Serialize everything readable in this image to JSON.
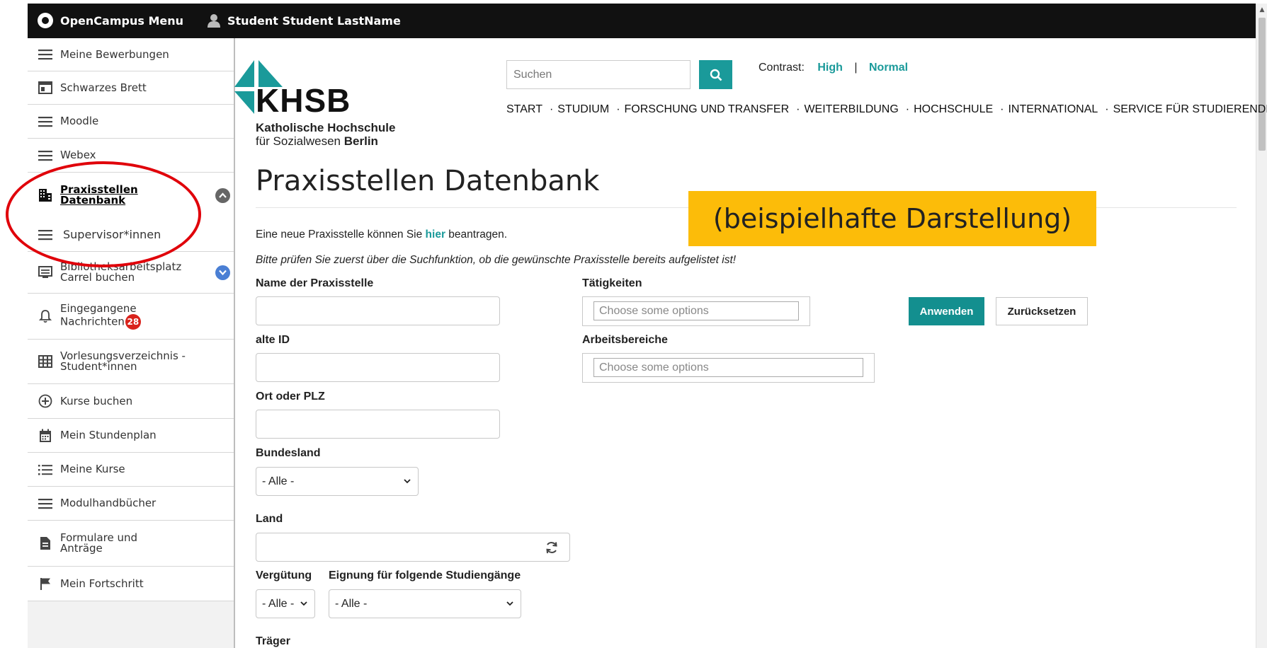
{
  "topbar": {
    "menu_label": "OpenCampus Menu",
    "user_label": "Student Student LastName"
  },
  "sidebar": {
    "items": [
      {
        "label": "Meine Bewerbungen",
        "icon": "hamburger-icon"
      },
      {
        "label": "Schwarzes Brett",
        "icon": "board-icon"
      },
      {
        "label": "Moodle",
        "icon": "hamburger-icon"
      },
      {
        "label": "Webex",
        "icon": "hamburger-icon"
      },
      {
        "label": "Praxisstellen Datenbank",
        "icon": "building-icon",
        "active": true
      },
      {
        "label": "Supervisor*innen",
        "icon": "hamburger-icon"
      },
      {
        "label": "Bibliotheksarbeitsplatz Carrel buchen",
        "icon": "monitor-icon"
      },
      {
        "label": "Eingegangene Nachrichten",
        "icon": "bell-icon",
        "badge": "28"
      },
      {
        "label": "Vorlesungsverzeichnis - Student*innen",
        "icon": "table-icon"
      },
      {
        "label": "Kurse buchen",
        "icon": "plus-circle-icon"
      },
      {
        "label": "Mein Stundenplan",
        "icon": "calendar-icon"
      },
      {
        "label": "Meine Kurse",
        "icon": "list-icon"
      },
      {
        "label": "Modulhandbücher",
        "icon": "hamburger-icon"
      },
      {
        "label": "Formulare und Anträge",
        "icon": "document-icon"
      },
      {
        "label": "Mein Fortschritt",
        "icon": "flag-icon"
      }
    ]
  },
  "logo": {
    "abbr": "KHSB",
    "line1": "Katholische Hochschule",
    "line2_prefix": "für Sozialwesen",
    "line2_bold": "Berlin"
  },
  "search": {
    "placeholder": "Suchen"
  },
  "contrast": {
    "label": "Contrast:",
    "high": "High",
    "separator": "|",
    "normal": "Normal"
  },
  "nav": {
    "items": [
      "START",
      "STUDIUM",
      "FORSCHUNG UND TRANSFER",
      "WEITERBILDUNG",
      "HOCHSCHULE",
      "INTERNATIONAL",
      "SERVICE FÜR STUDIERENDE"
    ],
    "separator": "·"
  },
  "page": {
    "title": "Praxisstellen Datenbank",
    "banner": "(beispielhafte Darstellung)",
    "intro_prefix": "Eine neue Praxisstelle können Sie",
    "intro_link": "hier",
    "intro_suffix": "beantragen.",
    "hint": "Bitte prüfen Sie zuerst über die Suchfunktion, ob die gewünschte Praxisstelle bereits aufgelistet ist!"
  },
  "form": {
    "name_label": "Name der Praxisstelle",
    "id_label": "alte ID",
    "ort_label": "Ort oder PLZ",
    "bundesland_label": "Bundesland",
    "bundesland_value": "- Alle -",
    "land_label": "Land",
    "verguetung_label": "Vergütung",
    "verguetung_value": "- Alle -",
    "eignung_label": "Eignung für folgende Studiengänge",
    "eignung_value": "- Alle -",
    "traeger_label": "Träger",
    "taetigkeiten_label": "Tätigkeiten",
    "taetigkeiten_placeholder": "Choose some options",
    "arbeitsbereiche_label": "Arbeitsbereiche",
    "arbeitsbereiche_placeholder": "Choose some options",
    "apply_label": "Anwenden",
    "reset_label": "Zurücksetzen"
  },
  "colors": {
    "accent": "#1a9a9a",
    "banner": "#fcbc09",
    "badge": "#d9231c",
    "highlight_ellipse": "#e0000a"
  }
}
